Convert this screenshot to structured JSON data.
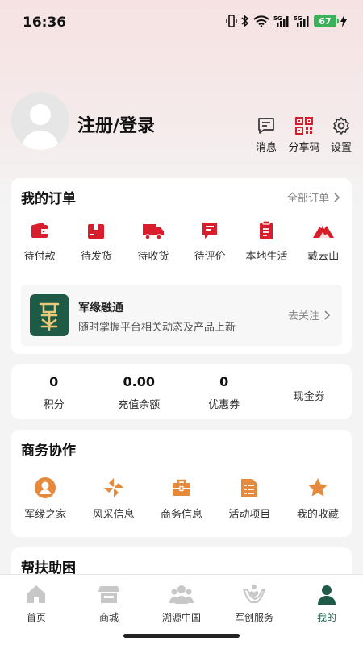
{
  "status": {
    "time": "16:36",
    "battery": "67"
  },
  "profile": {
    "login_label": "注册/登录"
  },
  "profile_actions": [
    {
      "label": "消息",
      "icon": "message-icon"
    },
    {
      "label": "分享码",
      "icon": "qr-code-icon"
    },
    {
      "label": "设置",
      "icon": "settings-icon"
    }
  ],
  "orders": {
    "title": "我的订单",
    "all_link": "全部订单",
    "items": [
      {
        "label": "待付款",
        "icon": "wallet-icon"
      },
      {
        "label": "待发货",
        "icon": "box-icon"
      },
      {
        "label": "待收货",
        "icon": "truck-icon"
      },
      {
        "label": "待评价",
        "icon": "comment-icon"
      },
      {
        "label": "本地生活",
        "icon": "clipboard-icon"
      },
      {
        "label": "戴云山",
        "icon": "mountain-icon"
      }
    ]
  },
  "promo": {
    "title": "军缘融通",
    "subtitle": "随时掌握平台相关动态及产品上新",
    "follow": "去关注"
  },
  "stats": [
    {
      "value": "0",
      "label": "积分"
    },
    {
      "value": "0.00",
      "label": "充值余额"
    },
    {
      "value": "0",
      "label": "优惠券"
    },
    {
      "value": "",
      "label": "现金券"
    }
  ],
  "business": {
    "title": "商务协作",
    "items": [
      {
        "label": "军缘之家",
        "icon": "person-circle-icon"
      },
      {
        "label": "风采信息",
        "icon": "pinwheel-icon"
      },
      {
        "label": "商务信息",
        "icon": "briefcase-icon"
      },
      {
        "label": "活动项目",
        "icon": "document-list-icon"
      },
      {
        "label": "我的收藏",
        "icon": "star-icon"
      }
    ]
  },
  "help": {
    "title": "帮扶助困"
  },
  "tabbar": [
    {
      "label": "首页",
      "icon": "home-icon",
      "active": false
    },
    {
      "label": "商城",
      "icon": "store-icon",
      "active": false
    },
    {
      "label": "溯源中国",
      "icon": "people-icon",
      "active": false
    },
    {
      "label": "军创服务",
      "icon": "hands-heart-icon",
      "active": false
    },
    {
      "label": "我的",
      "icon": "user-icon",
      "active": true
    }
  ],
  "colors": {
    "accent_red": "#d81e2c",
    "business_orange": "#e58a3c",
    "active_green": "#1f5a48",
    "inactive_gray": "#c7c7c7"
  }
}
